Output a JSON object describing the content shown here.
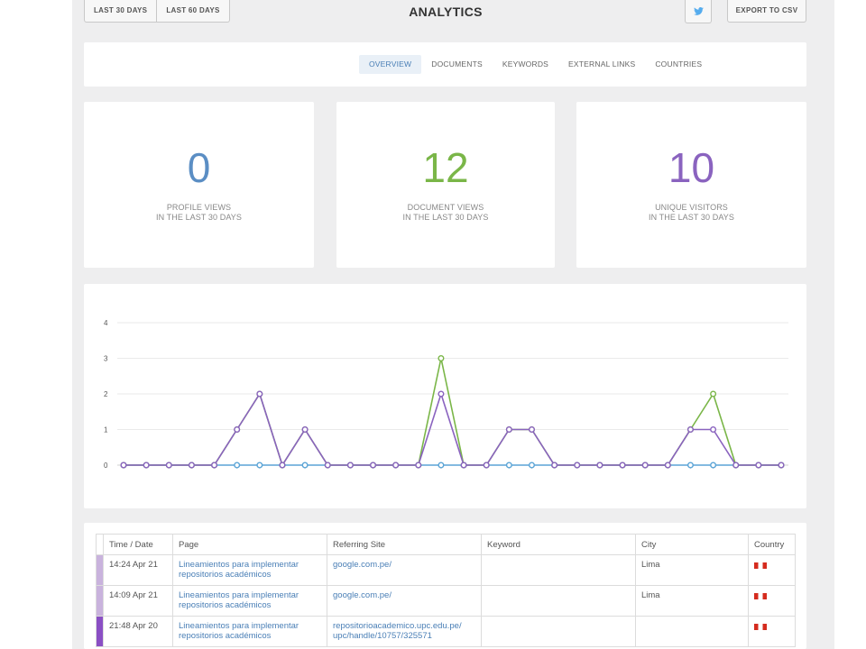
{
  "header": {
    "range_buttons": [
      "LAST 30 DAYS",
      "LAST 60 DAYS"
    ],
    "title": "ANALYTICS",
    "twitter_icon": "twitter-icon",
    "export_label": "EXPORT TO CSV"
  },
  "tabs": [
    {
      "label": "OVERVIEW",
      "active": true
    },
    {
      "label": "DOCUMENTS",
      "active": false
    },
    {
      "label": "KEYWORDS",
      "active": false
    },
    {
      "label": "EXTERNAL LINKS",
      "active": false
    },
    {
      "label": "COUNTRIES",
      "active": false
    }
  ],
  "stats": [
    {
      "value": "0",
      "line1": "PROFILE VIEWS",
      "line2": "IN THE LAST 30 DAYS",
      "color": "#5b8ec4"
    },
    {
      "value": "12",
      "line1": "DOCUMENT VIEWS",
      "line2": "IN THE LAST 30 DAYS",
      "color": "#7ab648"
    },
    {
      "value": "10",
      "line1": "UNIQUE VISITORS",
      "line2": "IN THE LAST 30 DAYS",
      "color": "#8a63bf"
    }
  ],
  "chart_data": {
    "type": "line",
    "ylim": [
      0,
      4
    ],
    "yticks": [
      0,
      1,
      2,
      3,
      4
    ],
    "grid": true,
    "x": [
      1,
      2,
      3,
      4,
      5,
      6,
      7,
      8,
      9,
      10,
      11,
      12,
      13,
      14,
      15,
      16,
      17,
      18,
      19,
      20,
      21,
      22,
      23,
      24,
      25,
      26,
      27,
      28,
      29,
      30
    ],
    "series": [
      {
        "color": "#5ba4d6",
        "values": [
          0,
          0,
          0,
          0,
          0,
          0,
          0,
          0,
          0,
          0,
          0,
          0,
          0,
          0,
          0,
          0,
          0,
          0,
          0,
          0,
          0,
          0,
          0,
          0,
          0,
          0,
          0,
          0,
          0,
          0
        ]
      },
      {
        "color": "#7ab648",
        "values": [
          0,
          0,
          0,
          0,
          0,
          1,
          2,
          0,
          1,
          0,
          0,
          0,
          0,
          0,
          3,
          0,
          0,
          1,
          1,
          0,
          0,
          0,
          0,
          0,
          0,
          1,
          2,
          0,
          0,
          0
        ]
      },
      {
        "color": "#8a63bf",
        "values": [
          0,
          0,
          0,
          0,
          0,
          1,
          2,
          0,
          1,
          0,
          0,
          0,
          0,
          0,
          2,
          0,
          0,
          1,
          1,
          0,
          0,
          0,
          0,
          0,
          0,
          1,
          1,
          0,
          0,
          0
        ]
      }
    ]
  },
  "table": {
    "headers": [
      "Time / Date",
      "Page",
      "Referring Site",
      "Keyword",
      "City",
      "Country"
    ],
    "rows": [
      {
        "marker_color": "#c9b3dd",
        "time": "14:24 Apr 21",
        "page": "Lineamientos para implementar repositorios académicos",
        "ref": "google.com.pe/",
        "keyword": "",
        "city": "Lima",
        "country_icon": "peru-flag-icon"
      },
      {
        "marker_color": "#c9b3dd",
        "time": "14:09 Apr 21",
        "page": "Lineamientos para implementar repositorios académicos",
        "ref": "google.com.pe/",
        "keyword": "",
        "city": "Lima",
        "country_icon": "peru-flag-icon"
      },
      {
        "marker_color": "#8a4fc4",
        "time": "21:48 Apr 20",
        "page": "Lineamientos para implementar repositorios académicos",
        "ref": "repositorioacademico.upc.edu.pe/ upc/handle/10757/325571",
        "keyword": "",
        "city": "",
        "country_icon": "peru-flag-icon"
      }
    ]
  }
}
